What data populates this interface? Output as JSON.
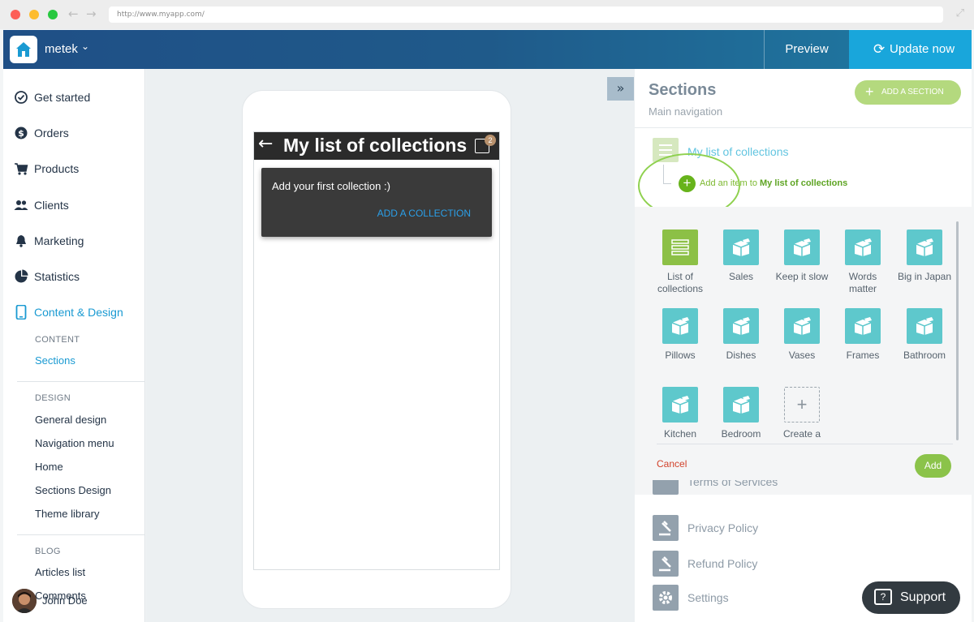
{
  "browser": {
    "url": "http://www.myapp.com/"
  },
  "topbar": {
    "app_name": "metek",
    "preview_label": "Preview",
    "update_label": "Update now"
  },
  "sidebar": {
    "items": [
      {
        "label": "Get started",
        "icon": "check-circle-icon"
      },
      {
        "label": "Orders",
        "icon": "dollar-circle-icon"
      },
      {
        "label": "Products",
        "icon": "cart-icon"
      },
      {
        "label": "Clients",
        "icon": "users-icon"
      },
      {
        "label": "Marketing",
        "icon": "bell-icon"
      },
      {
        "label": "Statistics",
        "icon": "pie-chart-icon"
      },
      {
        "label": "Content & Design",
        "icon": "phone-icon"
      }
    ],
    "content_heading": "CONTENT",
    "content_items": [
      "Sections"
    ],
    "design_heading": "DESIGN",
    "design_items": [
      "General design",
      "Navigation menu",
      "Home",
      "Sections Design",
      "Theme library"
    ],
    "blog_heading": "BLOG",
    "blog_items": [
      "Articles list",
      "Comments"
    ],
    "user_name": "John Doe"
  },
  "preview": {
    "title": "My list of collections",
    "cart_count": "2",
    "dialog_text": "Add your first collection :)",
    "dialog_button": "ADD A COLLECTION"
  },
  "panel": {
    "title": "Sections",
    "subtitle": "Main navigation",
    "add_section_label": "ADD A SECTION",
    "collection_label": "My list of collections",
    "add_item_prefix": "Add an item to ",
    "add_item_target": "My list of collections",
    "tiles": [
      {
        "label": "List of collections",
        "type": "list"
      },
      {
        "label": "Sales",
        "type": "collection"
      },
      {
        "label": "Keep it slow",
        "type": "collection"
      },
      {
        "label": "Words matter",
        "type": "collection"
      },
      {
        "label": "Big in Japan",
        "type": "collection"
      },
      {
        "label": "Pillows",
        "type": "collection"
      },
      {
        "label": "Dishes",
        "type": "collection"
      },
      {
        "label": "Vases",
        "type": "collection"
      },
      {
        "label": "Frames",
        "type": "collection"
      },
      {
        "label": "Bathroom",
        "type": "collection"
      },
      {
        "label": "Kitchen",
        "type": "collection"
      },
      {
        "label": "Bedroom",
        "type": "collection"
      },
      {
        "label": "Create a",
        "type": "create"
      }
    ],
    "cancel_label": "Cancel",
    "add_label": "Add",
    "pages": [
      {
        "label": "Terms of Services"
      },
      {
        "label": "Privacy Policy"
      },
      {
        "label": "Refund Policy"
      },
      {
        "label": "Settings"
      }
    ]
  },
  "support_label": "Support",
  "colors": {
    "accent": "#19a6db",
    "green": "#8cc046",
    "teal_tile": "#5ec8cc",
    "cancel_red": "#d2422b"
  }
}
